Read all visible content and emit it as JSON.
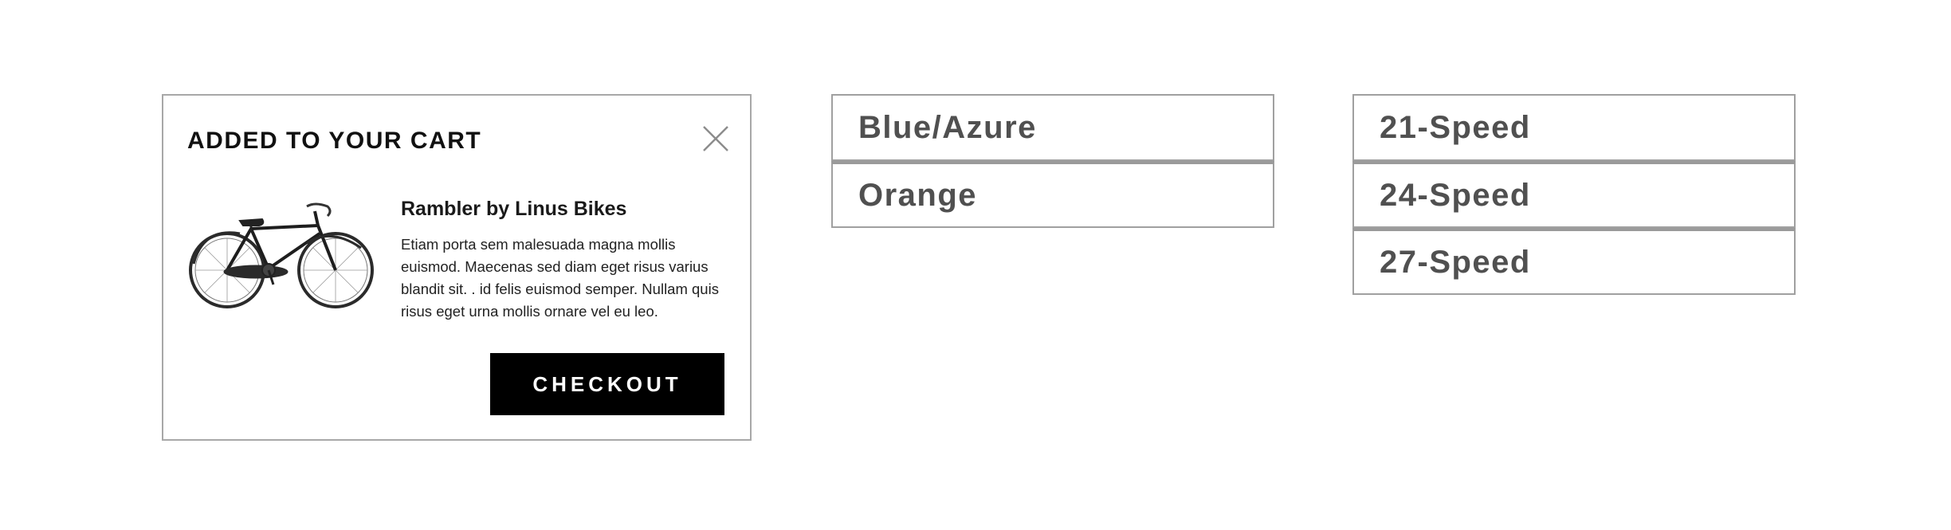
{
  "cart": {
    "title": "ADDED TO YOUR CART",
    "product": {
      "image": "bicycle-image",
      "name": "Rambler by Linus Bikes",
      "description": "Etiam porta sem malesuada magna mollis euismod. Maecenas sed diam eget risus varius blandit sit. . id felis euismod semper. Nullam quis risus eget urna mollis ornare vel eu leo."
    },
    "checkout_label": "CHECKOUT",
    "close_icon": "close-icon"
  },
  "color_options": [
    {
      "label": "Blue/Azure"
    },
    {
      "label": "Orange"
    }
  ],
  "speed_options": [
    {
      "label": "21-Speed"
    },
    {
      "label": "24-Speed"
    },
    {
      "label": "27-Speed"
    }
  ],
  "colors": {
    "border": "#a8a8a8",
    "button_bg": "#000000",
    "button_text": "#ffffff",
    "option_text": "#505050"
  }
}
